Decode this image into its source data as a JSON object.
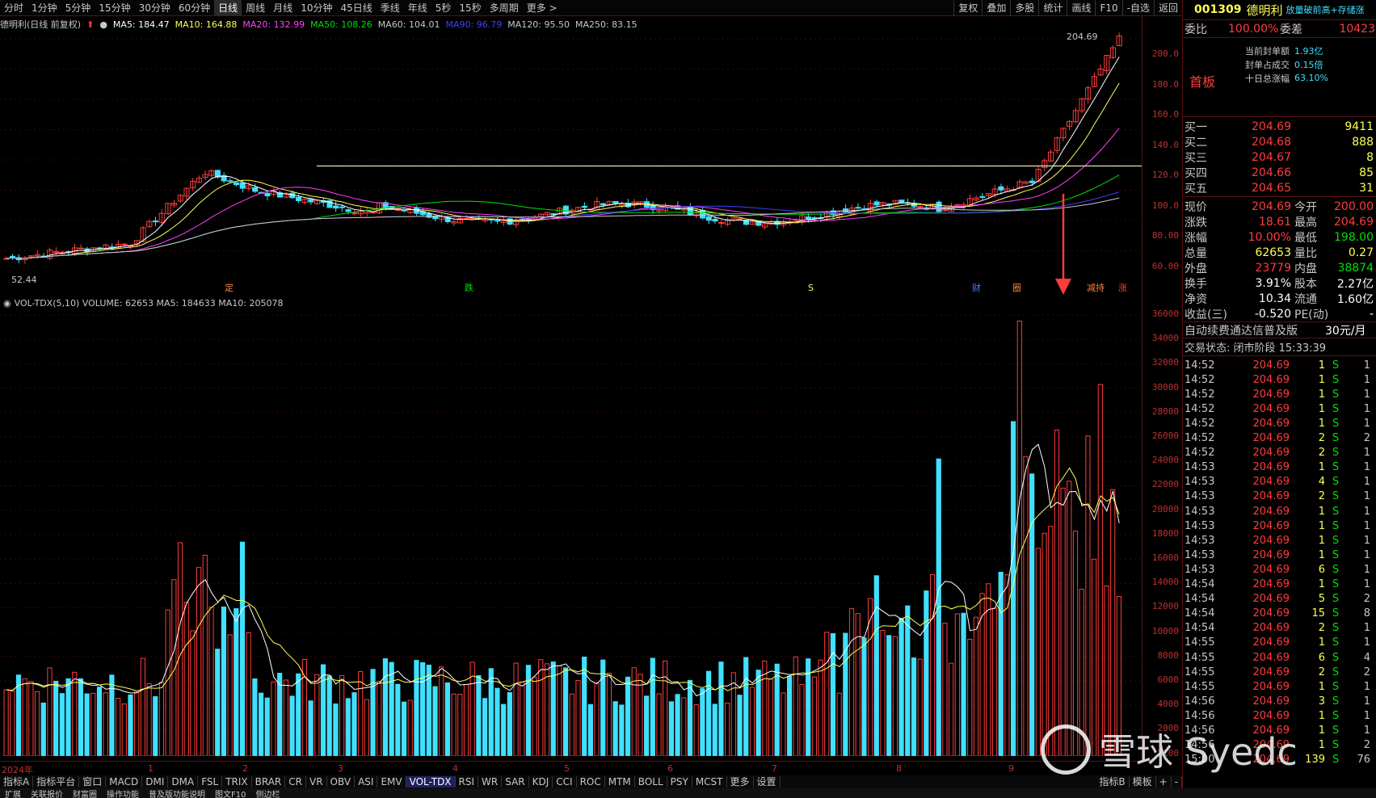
{
  "toolbar": {
    "periods": [
      "分时",
      "1分钟",
      "5分钟",
      "15分钟",
      "30分钟",
      "60分钟",
      "日线",
      "周线",
      "月线",
      "10分钟",
      "45日线",
      "季线",
      "年线",
      "5秒",
      "15秒",
      "多周期",
      "更多 >"
    ],
    "active_period": "日线",
    "right_items": [
      "复权",
      "叠加",
      "多股",
      "统计",
      "画线",
      "F10",
      "-自选",
      "返回"
    ]
  },
  "ma_legend": {
    "title": "德明利(日线 前复权)",
    "items": [
      {
        "label": "MA5: 184.47",
        "color": "#ffffff"
      },
      {
        "label": "MA10: 164.88",
        "color": "#ffff54"
      },
      {
        "label": "MA20: 132.99",
        "color": "#ff40ff"
      },
      {
        "label": "MA50: 108.26",
        "color": "#00e000"
      },
      {
        "label": "MA60: 104.01",
        "color": "#c8c8c8"
      },
      {
        "label": "MA90: 96.79",
        "color": "#4040ff"
      },
      {
        "label": "MA120: 95.50",
        "color": "#c8c8c8"
      },
      {
        "label": "MA250: 83.15",
        "color": "#c8c8c8"
      }
    ]
  },
  "price_axis": {
    "ticks": [
      "200.0",
      "180.0",
      "160.0",
      "140.0",
      "120.0",
      "100.0",
      "80.00",
      "60.00"
    ],
    "max_label": "204.69",
    "min_label": "52.44"
  },
  "event_markers": [
    "定",
    "跌",
    "S",
    "财",
    "圈",
    "减持",
    "涨"
  ],
  "vol_legend": {
    "label": "VOL-TDX(5,10)  VOLUME: 62653  MA5: 184633  MA10: 205078"
  },
  "vol_axis": {
    "ticks": [
      "36000",
      "34000",
      "32000",
      "30000",
      "28000",
      "26000",
      "24000",
      "22000",
      "20000",
      "18000",
      "16000",
      "14000",
      "12000",
      "10000",
      "8000",
      "6000",
      "4000",
      "2000"
    ],
    "unit": "X100"
  },
  "months": [
    "2024年",
    "1",
    "2",
    "3",
    "4",
    "5",
    "6",
    "7",
    "8",
    "9"
  ],
  "indicator_tabs": [
    "指标A",
    "指标平台",
    "窗口",
    "MACD",
    "DMI",
    "DMA",
    "FSL",
    "TRIX",
    "BRAR",
    "CR",
    "VR",
    "OBV",
    "ASI",
    "EMV",
    "VOL-TDX",
    "RSI",
    "WR",
    "SAR",
    "KDJ",
    "CCI",
    "ROC",
    "MTM",
    "BOLL",
    "PSY",
    "MCST",
    "更多",
    "设置"
  ],
  "indicator_tabs_right": [
    "指标B",
    "模板",
    "+",
    "-"
  ],
  "bottom_bar": [
    "扩展",
    "关联报价",
    "财富圈",
    "操作功能",
    "普及版功能说明",
    "图文F10",
    "侧边栏"
  ],
  "stock": {
    "code": "001309",
    "name": "德明利",
    "tag": "放量破前高+存储涨",
    "weibi_label": "委比",
    "weibi": "100.00%",
    "weicha_label": "委差",
    "weicha": "10423",
    "board": "首板",
    "info": [
      {
        "label": "当前封单额",
        "value": "1.93亿"
      },
      {
        "label": "封单占成交",
        "value": "0.15倍"
      },
      {
        "label": "十日总涨幅",
        "value": "63.10%"
      }
    ],
    "bids": [
      {
        "label": "买一",
        "price": "204.69",
        "vol": "9411"
      },
      {
        "label": "买二",
        "price": "204.68",
        "vol": "888"
      },
      {
        "label": "买三",
        "price": "204.67",
        "vol": "8"
      },
      {
        "label": "买四",
        "price": "204.66",
        "vol": "85"
      },
      {
        "label": "买五",
        "price": "204.65",
        "vol": "31"
      }
    ],
    "quote": [
      {
        "l1": "现价",
        "v1": "204.69",
        "l2": "今开",
        "v2": "200.00"
      },
      {
        "l1": "涨跌",
        "v1": "18.61",
        "l2": "最高",
        "v2": "204.69"
      },
      {
        "l1": "涨幅",
        "v1": "10.00%",
        "l2": "最低",
        "v2": "198.00"
      },
      {
        "l1": "总量",
        "v1": "62653",
        "l2": "量比",
        "v2": "0.27"
      },
      {
        "l1": "外盘",
        "v1": "23779",
        "l2": "内盘",
        "v2": "38874"
      },
      {
        "l1": "换手",
        "v1": "3.91%",
        "l2": "股本",
        "v2": "2.27亿"
      },
      {
        "l1": "净资",
        "v1": "10.34",
        "l2": "流通",
        "v2": "1.60亿"
      },
      {
        "l1": "收益(三)",
        "v1": "-0.520",
        "l2": "PE(动)",
        "v2": "-"
      }
    ],
    "promo": "自动续费通达信普及版",
    "promo_price": "30元/月",
    "status": "交易状态: 闭市阶段 15:33:39",
    "ticks": [
      {
        "t": "14:52",
        "p": "204.69",
        "q": "1",
        "s": "S",
        "n": "1"
      },
      {
        "t": "14:52",
        "p": "204.69",
        "q": "1",
        "s": "S",
        "n": "1"
      },
      {
        "t": "14:52",
        "p": "204.69",
        "q": "1",
        "s": "S",
        "n": "1"
      },
      {
        "t": "14:52",
        "p": "204.69",
        "q": "1",
        "s": "S",
        "n": "1"
      },
      {
        "t": "14:52",
        "p": "204.69",
        "q": "1",
        "s": "S",
        "n": "1"
      },
      {
        "t": "14:52",
        "p": "204.69",
        "q": "2",
        "s": "S",
        "n": "2"
      },
      {
        "t": "14:52",
        "p": "204.69",
        "q": "2",
        "s": "S",
        "n": "1"
      },
      {
        "t": "14:53",
        "p": "204.69",
        "q": "1",
        "s": "S",
        "n": "1"
      },
      {
        "t": "14:53",
        "p": "204.69",
        "q": "4",
        "s": "S",
        "n": "1"
      },
      {
        "t": "14:53",
        "p": "204.69",
        "q": "2",
        "s": "S",
        "n": "1"
      },
      {
        "t": "14:53",
        "p": "204.69",
        "q": "1",
        "s": "S",
        "n": "1"
      },
      {
        "t": "14:53",
        "p": "204.69",
        "q": "1",
        "s": "S",
        "n": "1"
      },
      {
        "t": "14:53",
        "p": "204.69",
        "q": "1",
        "s": "S",
        "n": "1"
      },
      {
        "t": "14:53",
        "p": "204.69",
        "q": "1",
        "s": "S",
        "n": "1"
      },
      {
        "t": "14:53",
        "p": "204.69",
        "q": "6",
        "s": "S",
        "n": "1"
      },
      {
        "t": "14:54",
        "p": "204.69",
        "q": "1",
        "s": "S",
        "n": "1"
      },
      {
        "t": "14:54",
        "p": "204.69",
        "q": "5",
        "s": "S",
        "n": "2"
      },
      {
        "t": "14:54",
        "p": "204.69",
        "q": "15",
        "s": "S",
        "n": "8"
      },
      {
        "t": "14:54",
        "p": "204.69",
        "q": "2",
        "s": "S",
        "n": "1"
      },
      {
        "t": "14:55",
        "p": "204.69",
        "q": "1",
        "s": "S",
        "n": "1"
      },
      {
        "t": "14:55",
        "p": "204.69",
        "q": "6",
        "s": "S",
        "n": "4"
      },
      {
        "t": "14:55",
        "p": "204.69",
        "q": "2",
        "s": "S",
        "n": "2"
      },
      {
        "t": "14:55",
        "p": "204.69",
        "q": "1",
        "s": "S",
        "n": "1"
      },
      {
        "t": "14:56",
        "p": "204.69",
        "q": "3",
        "s": "S",
        "n": "1"
      },
      {
        "t": "14:56",
        "p": "204.69",
        "q": "1",
        "s": "S",
        "n": "1"
      },
      {
        "t": "14:56",
        "p": "204.69",
        "q": "1",
        "s": "S",
        "n": "1"
      },
      {
        "t": "14:56",
        "p": "204.69",
        "q": "1",
        "s": "S",
        "n": "2"
      },
      {
        "t": "15:00",
        "p": "204.69",
        "q": "139",
        "s": "S",
        "n": "76"
      }
    ]
  },
  "watermark": "雪球 Syedc"
}
